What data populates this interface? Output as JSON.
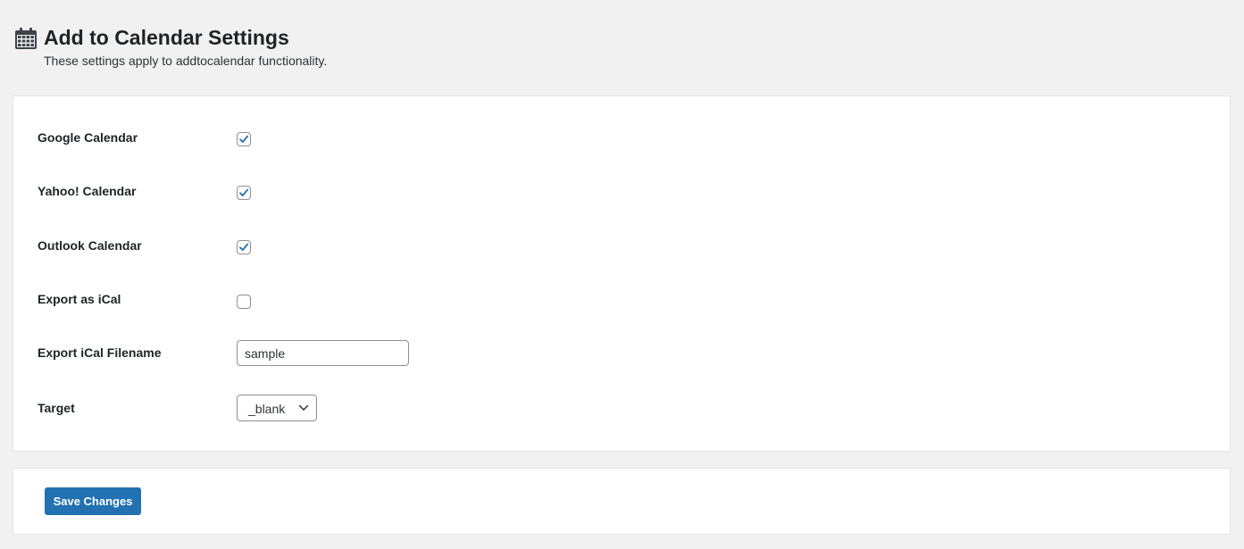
{
  "header": {
    "title": "Add to Calendar Settings",
    "subtitle": "These settings apply to addtocalendar functionality.",
    "icon": "calendar-icon"
  },
  "settings": {
    "google_calendar": {
      "label": "Google Calendar",
      "checked": true
    },
    "yahoo_calendar": {
      "label": "Yahoo! Calendar",
      "checked": true
    },
    "outlook_calendar": {
      "label": "Outlook Calendar",
      "checked": true
    },
    "export_ical": {
      "label": "Export as iCal",
      "checked": false
    },
    "ical_filename": {
      "label": "Export iCal Filename",
      "value": "sample"
    },
    "target": {
      "label": "Target",
      "value": "_blank"
    }
  },
  "actions": {
    "save_label": "Save Changes"
  },
  "colors": {
    "accent": "#2271b1",
    "background": "#f1f1f1",
    "panel": "#ffffff"
  }
}
